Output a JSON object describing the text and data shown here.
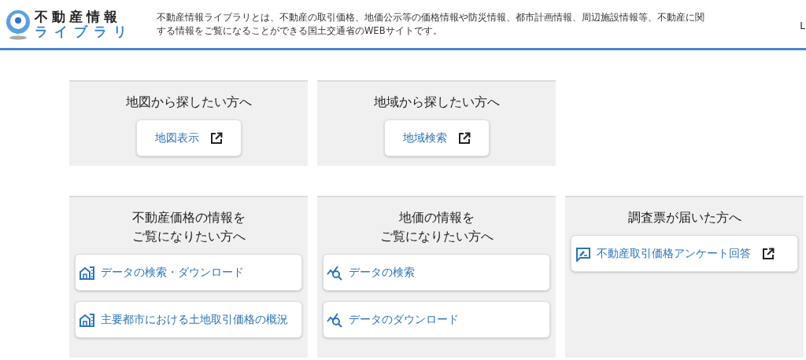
{
  "header": {
    "logo_title": "不動産情報",
    "logo_subtitle": "ライブラリ",
    "description_lines": [
      "不動産情報ライブラリとは、不動産の取引価格、地価公示等の価格情報や防災情報、都市計画情報、周辺施設情報等、不動産に関",
      "する情報をご覧になることができる国土交通省のWEBサイトです。"
    ],
    "edge_text": "L"
  },
  "rows": [
    {
      "panels": [
        {
          "title_lines": [
            "地図から探したい方へ"
          ],
          "links": [
            {
              "label": "地図表示",
              "kind": "plain",
              "external": true
            }
          ]
        },
        {
          "title_lines": [
            "地域から探したい方へ"
          ],
          "links": [
            {
              "label": "地域検索",
              "kind": "plain",
              "external": true
            }
          ]
        }
      ]
    },
    {
      "panels": [
        {
          "title_lines": [
            "不動産価格の情報を",
            "ご覧になりたい方へ"
          ],
          "links": [
            {
              "label": "データの検索・ダウンロード",
              "kind": "building",
              "external": false
            },
            {
              "label": "主要都市における土地取引価格の概況",
              "kind": "building",
              "external": false
            }
          ]
        },
        {
          "title_lines": [
            "地価の情報を",
            "ご覧になりたい方へ"
          ],
          "links": [
            {
              "label": "データの検索",
              "kind": "chart",
              "external": false
            },
            {
              "label": "データのダウンロード",
              "kind": "chart",
              "external": false
            }
          ]
        },
        {
          "title_lines": [
            "調査票が届いた方へ"
          ],
          "links": [
            {
              "label": "不動産取引価格アンケート回答",
              "kind": "form",
              "external": true
            }
          ]
        }
      ]
    }
  ]
}
